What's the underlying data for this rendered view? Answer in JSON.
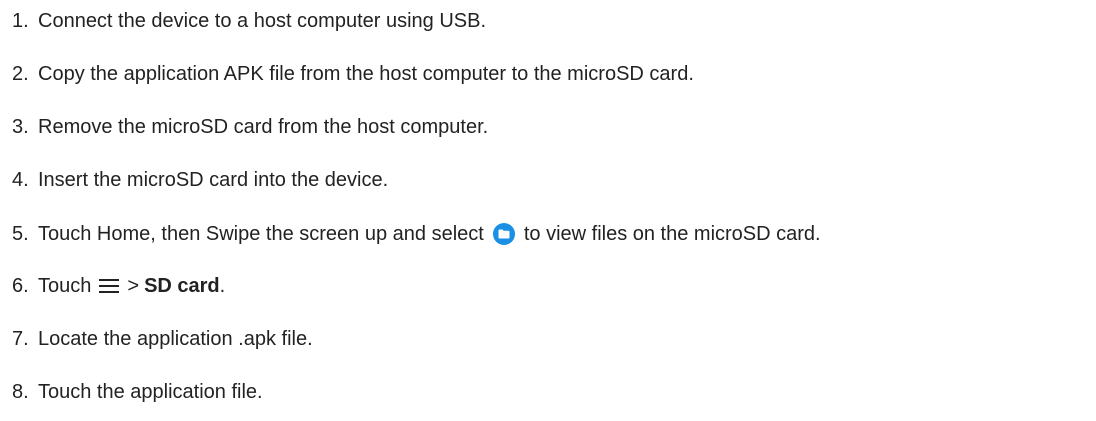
{
  "steps": [
    {
      "number": "1.",
      "text": "Connect the device to a host computer using USB."
    },
    {
      "number": "2.",
      "text": "Copy the application APK file from the host computer to the microSD card."
    },
    {
      "number": "3.",
      "text": "Remove the microSD card from the host computer."
    },
    {
      "number": "4.",
      "text": "Insert the microSD card into the device."
    },
    {
      "number": "5.",
      "text_before": "Touch Home, then Swipe the screen up and select",
      "icon": "files-folder-icon",
      "text_after": "to view files on the microSD card."
    },
    {
      "number": "6.",
      "text_before": "Touch",
      "icon": "hamburger-menu-icon",
      "text_mid": ">",
      "bold_text": "SD card",
      "text_after": "."
    },
    {
      "number": "7.",
      "text": "Locate the application .apk file."
    },
    {
      "number": "8.",
      "text": "Touch the application file."
    }
  ],
  "colors": {
    "text": "#222222",
    "folder_icon": "#1a8fe3"
  }
}
